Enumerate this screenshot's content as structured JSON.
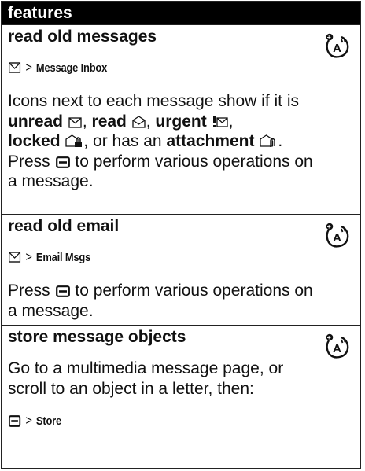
{
  "header": {
    "title": "features"
  },
  "sections": [
    {
      "title": "read old messages",
      "path": {
        "start": "Message Inbox"
      },
      "body": {
        "p1": "Icons next to each message show if it is",
        "unread": "unread",
        "read": "read",
        "urgent": "urgent",
        "locked": "locked",
        "or_has_an": ", or has an",
        "attachment": "attachment",
        "line4": "Press",
        "line4_rest": "to perform various operations on",
        "line5": "a message."
      }
    },
    {
      "title": "read old email",
      "path": {
        "start": "Email Msgs"
      },
      "body": {
        "press": "Press",
        "rest": "to perform various operations on",
        "line2": "a message."
      }
    },
    {
      "title": "store message objects",
      "body": {
        "line1": "Go to a multimedia message page, or",
        "line2": "scroll to an object in a letter, then:"
      },
      "path": {
        "start": "Store"
      }
    }
  ],
  "icons": [
    "network-feature-icon",
    "envelope-icon",
    "menu-key-icon",
    "read-message-icon",
    "urgent-message-icon",
    "locked-message-icon",
    "attachment-message-icon"
  ]
}
